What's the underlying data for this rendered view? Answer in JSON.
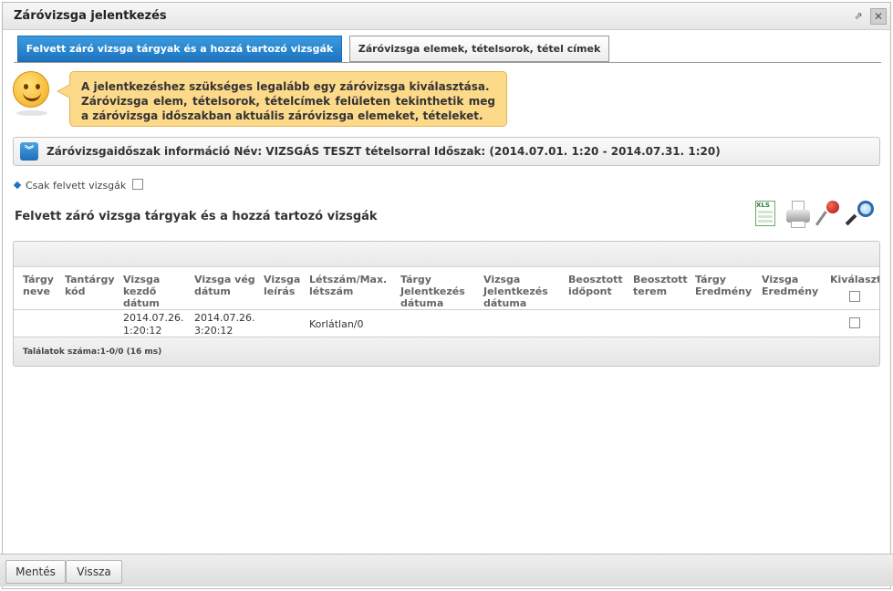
{
  "window": {
    "title": "Záróvizsga jelentkezés"
  },
  "tabs": [
    {
      "label": "Felvett záró vizsga tárgyak és a hozzá tartozó vizsgák",
      "active": true
    },
    {
      "label": "Záróvizsga elemek, tételsorok, tétel címek",
      "active": false
    }
  ],
  "notice": {
    "line1": "A jelentkezéshez szükséges legalább egy záróvizsga kiválasztása.",
    "line2": "Záróvizsga elem, tételsorok, tételcímek felületen tekinthetik meg a záróvizsga időszakban aktuális záróvizsga elemeket, tételeket."
  },
  "info_bar": {
    "text": "Záróvizsgaidőszak információ Név: VIZSGÁS TESZT tételsorral Időszak: (2014.07.01. 1:20 - 2014.07.31. 1:20)"
  },
  "filter": {
    "label": "Csak felvett vizsgák",
    "checked": false
  },
  "section_title": "Felvett záró vizsga tárgyak és a hozzá tartozó vizsgák",
  "tools": [
    "xls-icon",
    "print-icon",
    "pin-icon",
    "zoom-icon"
  ],
  "table": {
    "columns": [
      [
        "Tárgy",
        "neve"
      ],
      [
        "Tantárgy",
        "kód"
      ],
      [
        "Vizsga",
        "kezdő",
        "dátum"
      ],
      [
        "Vizsga vég",
        "dátum"
      ],
      [
        "Vizsga",
        "leírás"
      ],
      [
        "Létszám/Max.",
        "létszám"
      ],
      [
        "Tárgy",
        "Jelentkezés",
        "dátuma"
      ],
      [
        "Vizsga",
        "Jelentkezés",
        "dátuma"
      ],
      [
        "Beosztott",
        "időpont"
      ],
      [
        "Beosztott",
        "terem"
      ],
      [
        "Tárgy",
        "Eredmény"
      ],
      [
        "Vizsga",
        "Eredmény"
      ],
      [
        "Kiválaszt"
      ]
    ],
    "rows": [
      {
        "start_date_1": "2014.07.26.",
        "start_date_2": "1:20:12",
        "end_date_1": "2014.07.26.",
        "end_date_2": "3:20:12",
        "capacity": "Korlátlan/0",
        "selected": false
      }
    ],
    "footer": "Találatok száma:1-0/0 (16 ms)"
  },
  "buttons": {
    "save": "Mentés",
    "back": "Vissza"
  }
}
